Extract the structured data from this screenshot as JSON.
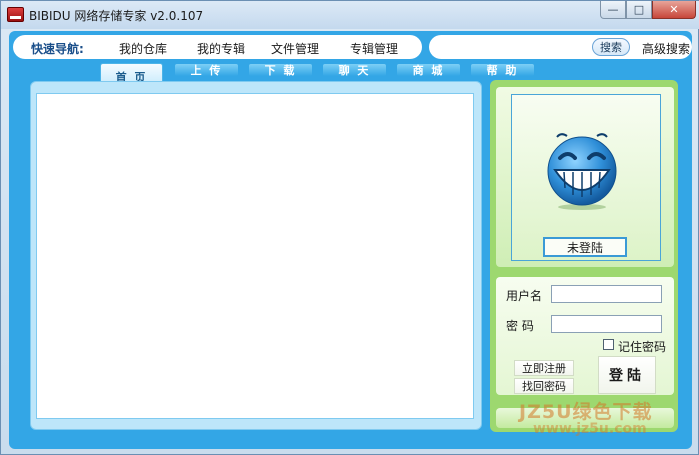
{
  "window": {
    "title": "BIBIDU 网络存储专家  v2.0.107",
    "minimize_glyph": "—",
    "maximize_glyph": "□",
    "close_glyph": "✕"
  },
  "nav": {
    "title": "快速导航:",
    "links": [
      "我的仓库",
      "我的专辑",
      "文件管理",
      "专辑管理"
    ]
  },
  "search": {
    "button_label": "搜索",
    "advanced_label": "高级搜索"
  },
  "tabs": [
    "首 页",
    "上 传",
    "下 载",
    "聊 天",
    "商 城",
    "帮 助"
  ],
  "account": {
    "status_label": "未登陆",
    "username_label": "用户名",
    "password_label": "密  码",
    "username_value": "",
    "password_value": "",
    "remember_label": "记住密码",
    "remember_checked": false,
    "register_label": "立即注册",
    "recover_label": "找回密码",
    "login_label": "登陆"
  },
  "watermark": {
    "line1": "JZ5U绿色下载",
    "line2": "www.jz5u.com"
  },
  "colors": {
    "frame_blue": "#33a6e6",
    "side_green": "#9dd86f",
    "avatar_blue": "#2f8fd8"
  }
}
